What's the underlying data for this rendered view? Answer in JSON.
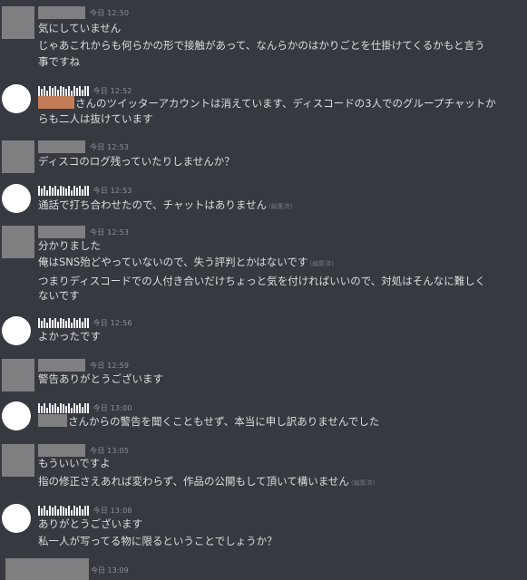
{
  "messages": [
    {
      "author": "redacted",
      "avatar_type": "redacted-square",
      "timestamp": "今日 12:50",
      "lines": [
        "気にしていません",
        "じゃあこれからも何らかの形で接触があって、なんらかのはかりごとを仕掛けてくるかもと言う",
        "事ですね"
      ]
    },
    {
      "author": "illegible",
      "avatar_type": "white-circle",
      "timestamp": "今日 12:52",
      "lines": [
        "さんのツイッターアカウントは消えています、ディスコードの3人でのグループチャットか",
        "らも二人は抜けています"
      ]
    },
    {
      "author": "redacted",
      "avatar_type": "redacted-square",
      "timestamp": "今日 12:53",
      "lines": [
        "ディスコのログ残っていたりしませんか？"
      ]
    },
    {
      "author": "illegible",
      "avatar_type": "white-circle",
      "timestamp": "今日 12:53",
      "lines": [
        "通話で打ち合わせたので、チャットはありません"
      ],
      "edited": "(編集済)"
    },
    {
      "author": "redacted",
      "avatar_type": "redacted-square",
      "timestamp": "今日 12:53",
      "lines": [
        "分かりました",
        "俺はSNS殆どやっていないので、失う評判とかはないです",
        "つまりディスコードでの人付き合いだけちょっと気を付ければいいので、対処はそんなに難しく",
        "ないです"
      ],
      "edited": "(編集済)"
    },
    {
      "author": "illegible",
      "avatar_type": "white-circle",
      "timestamp": "今日 12:56",
      "lines": [
        "よかったです"
      ]
    },
    {
      "author": "redacted",
      "avatar_type": "redacted-square",
      "timestamp": "今日 12:59",
      "lines": [
        "警告ありがとうございます"
      ]
    },
    {
      "author": "illegible",
      "avatar_type": "white-circle",
      "timestamp": "今日 13:00",
      "lines": [
        "さんからの警告を聞くこともせず、本当に申し訳ありませんでした"
      ]
    },
    {
      "author": "redacted",
      "avatar_type": "redacted-square",
      "timestamp": "今日 13:05",
      "lines": [
        "もういいですよ",
        "指の修正さえあれば変わらず、作品の公開もして頂いて構いません"
      ],
      "edited": "(編集済)"
    },
    {
      "author": "illegible",
      "avatar_type": "white-circle",
      "timestamp": "今日 13:08",
      "lines": [
        "ありがとうございます",
        "私一人が写ってる物に限るということでしょうか？"
      ]
    },
    {
      "author": "redacted",
      "avatar_type": "redacted-square",
      "timestamp": "今日 13:09",
      "lines": []
    }
  ],
  "colors": {
    "background": "#36393f",
    "text": "#dcddde",
    "timestamp": "#8e9297",
    "redaction": "#7f7f82",
    "redaction_orange": "#c27c58"
  }
}
